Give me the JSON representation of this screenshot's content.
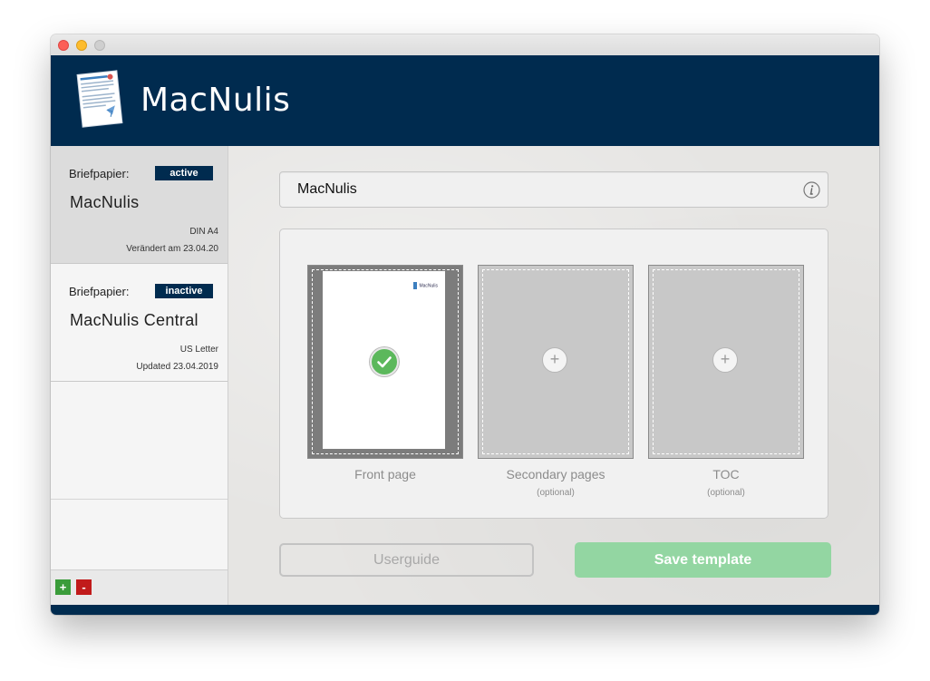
{
  "app": {
    "brand": "MacNulis"
  },
  "sidebar": {
    "templates": [
      {
        "kind_label": "Briefpapier:",
        "status": "active",
        "name": "MacNulis",
        "paper_size": "DIN A4",
        "updated": "Verändert am 23.04.20",
        "selected": true
      },
      {
        "kind_label": "Briefpapier:",
        "status": "inactive",
        "name": "MacNulis Central",
        "paper_size": "US Letter",
        "updated": "Updated 23.04.2019",
        "selected": false
      }
    ],
    "add_label": "+",
    "remove_label": "-"
  },
  "editor": {
    "name_value": "MacNulis",
    "info_icon": "info-icon",
    "preview_logo_text": "MacNulis",
    "slots": [
      {
        "label": "Front page",
        "sub": "",
        "state": "selected",
        "icon": "check-icon"
      },
      {
        "label": "Secondary pages",
        "sub": "(optional)",
        "state": "empty",
        "icon": "plus-icon"
      },
      {
        "label": "TOC",
        "sub": "(optional)",
        "state": "empty",
        "icon": "plus-icon"
      }
    ],
    "plus_glyph": "+"
  },
  "actions": {
    "userguide_label": "Userguide",
    "save_label": "Save template"
  },
  "colors": {
    "brand_navy": "#002b4f",
    "save_green": "#93d6a2",
    "check_green": "#5cb85c",
    "remove_red": "#c11b1b",
    "add_green": "#3a9c3a"
  }
}
